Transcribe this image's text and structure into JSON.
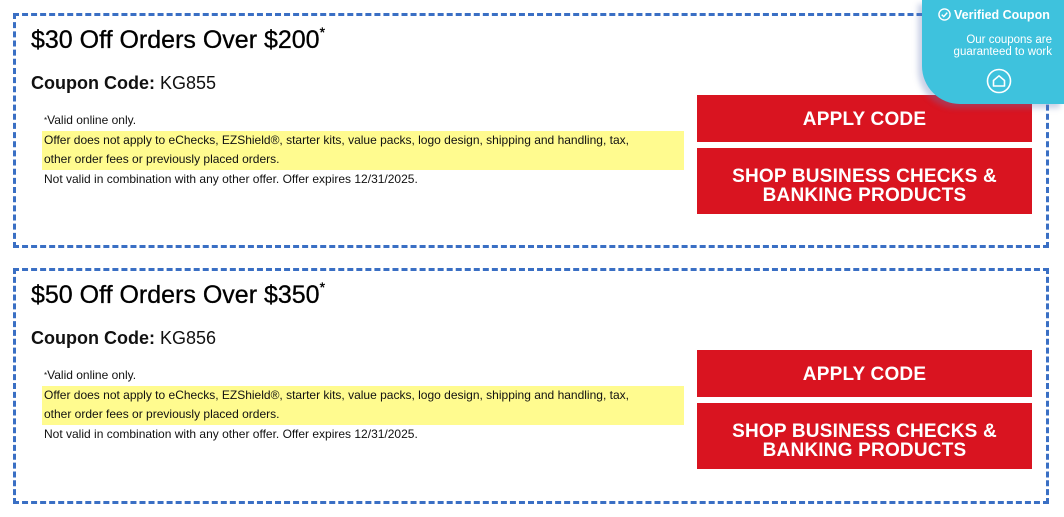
{
  "badge": {
    "title": "Verified Coupon",
    "subtitle": "Our coupons are guaranteed to work",
    "color": "#3ec2dd"
  },
  "coupons": [
    {
      "headline": "$30 Off Orders Over $200",
      "asterisk": "*",
      "code_label": "Coupon Code:",
      "code": "KG855",
      "terms_line1_asterisk": "*",
      "terms_line1": "Valid online only.",
      "terms_highlight_1": "Offer does not apply to eChecks, EZShield®, starter kits, value packs, logo design, shipping and handling, tax,",
      "terms_highlight_2": "other order fees or previously placed orders.",
      "terms_line3": "Not valid in combination with any other offer. Offer expires 12/31/2025.",
      "apply_label": "APPLY CODE",
      "shop_label_1": "SHOP BUSINESS CHECKS &",
      "shop_label_2": "BANKING PRODUCTS"
    },
    {
      "headline": "$50 Off Orders Over $350",
      "asterisk": "*",
      "code_label": "Coupon Code:",
      "code": "KG856",
      "terms_line1_asterisk": "*",
      "terms_line1": "Valid online only.",
      "terms_highlight_1": "Offer does not apply to eChecks, EZShield®, starter kits, value packs, logo design, shipping and handling, tax,",
      "terms_highlight_2": "other order fees or previously placed orders.",
      "terms_line3": "Not valid in combination with any other offer. Offer expires 12/31/2025.",
      "apply_label": "APPLY CODE",
      "shop_label_1": "SHOP BUSINESS CHECKS &",
      "shop_label_2": "BANKING PRODUCTS"
    }
  ],
  "colors": {
    "button_red": "#d91420",
    "dashed_border": "#3a6fc4",
    "highlight": "#fffb8f"
  },
  "icons": {
    "badge_check": "check-circle-icon",
    "badge_home": "home-icon"
  }
}
